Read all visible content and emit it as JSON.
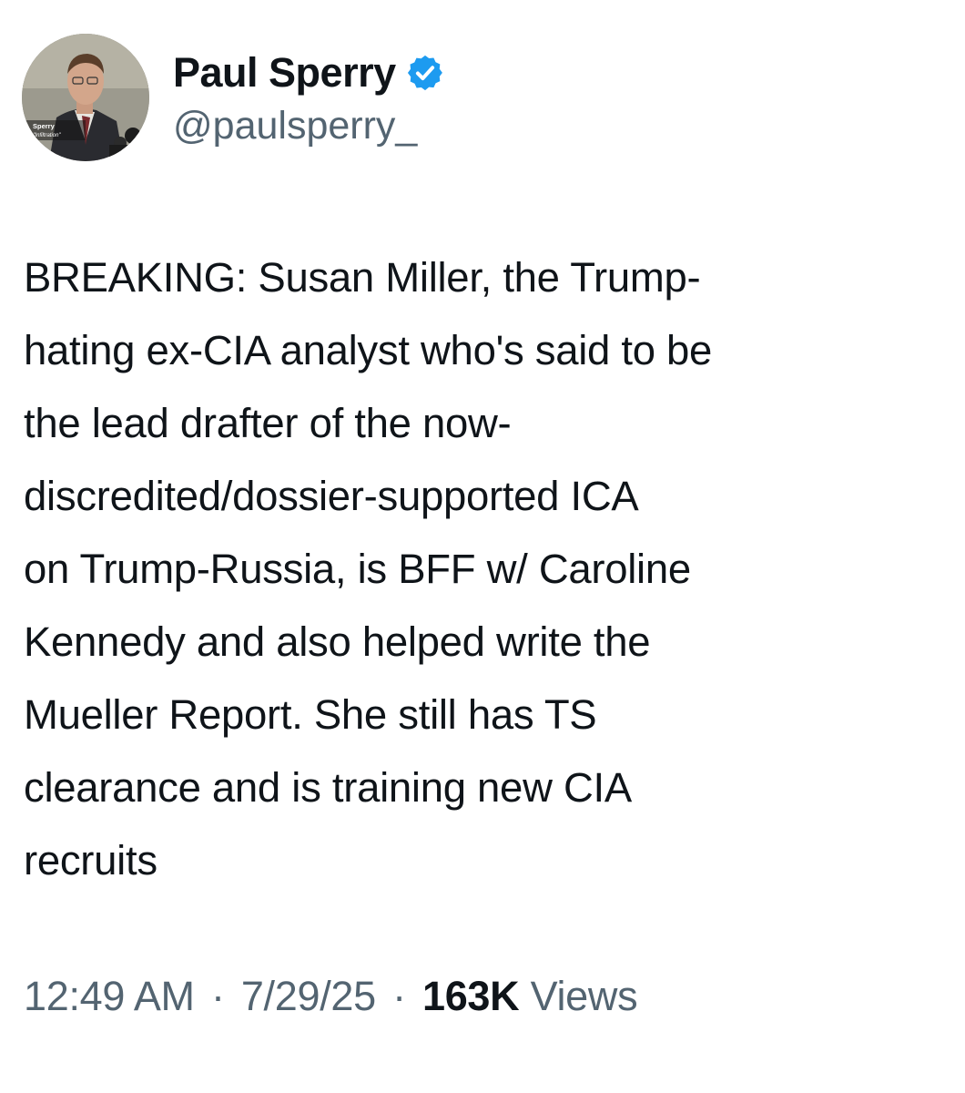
{
  "author": {
    "display_name": "Paul Sperry",
    "handle": "@paulsperry_",
    "verified_color": "#1d9bf0",
    "avatar_caption_line1": "Sperry",
    "avatar_caption_line2": "or, \"Infiltration\""
  },
  "tweet": {
    "lines": [
      "BREAKING: Susan Miller, the Trump-",
      "hating ex-CIA analyst who's said to be",
      "the lead drafter of the now-",
      "discredited/dossier-supported ICA",
      "on Trump-Russia, is BFF w/ Caroline",
      "Kennedy and also helped write the",
      "Mueller Report. She still has TS",
      "clearance and is training new CIA",
      "recruits"
    ]
  },
  "meta": {
    "time": "12:49 AM",
    "separator": "·",
    "date": "7/29/25",
    "views_count": "163K",
    "views_label": "Views"
  },
  "colors": {
    "text_primary": "#0f1419",
    "text_secondary": "#536471",
    "verified": "#1d9bf0",
    "background": "#ffffff"
  }
}
